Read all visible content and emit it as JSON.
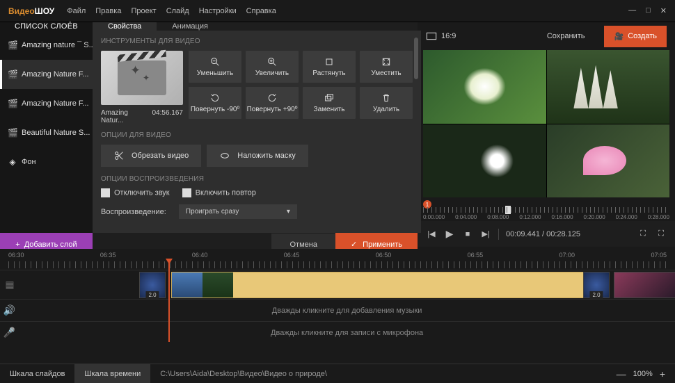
{
  "app": {
    "logo1": "Видео",
    "logo2": "ШОУ"
  },
  "menu": [
    "Файл",
    "Правка",
    "Проект",
    "Слайд",
    "Настройки",
    "Справка"
  ],
  "left": {
    "layers_title": "СПИСОК СЛОЁВ",
    "tabs": {
      "props": "Свойства",
      "anim": "Анимация"
    },
    "layers": [
      {
        "label": "Amazing nature ¯ S..."
      },
      {
        "label": "Amazing Nature F..."
      },
      {
        "label": "Amazing Nature F..."
      },
      {
        "label": "Beautiful Nature S..."
      },
      {
        "label": "Фон"
      }
    ],
    "sections": {
      "video_tools": "ИНСТРУМЕНТЫ ДЛЯ ВИДЕО",
      "video_opts": "ОПЦИИ ДЛЯ ВИДЕО",
      "play_opts": "ОПЦИИ ВОСПРОИЗВЕДЕНИЯ"
    },
    "thumb": {
      "name": "Amazing Natur...",
      "duration": "04:56.167"
    },
    "tools": {
      "zoom_out": "Уменьшить",
      "zoom_in": "Увеличить",
      "stretch": "Растянуть",
      "fit": "Уместить",
      "rot_left": "Повернуть -90º",
      "rot_right": "Повернуть +90º",
      "replace": "Заменить",
      "delete": "Удалить"
    },
    "wide": {
      "crop": "Обрезать видео",
      "mask": "Наложить маску"
    },
    "checks": {
      "mute": "Отключить звук",
      "loop": "Включить повтор"
    },
    "playback_label": "Воспроизведение:",
    "playback_value": "Проиграть сразу",
    "add_layer": "Добавить слой",
    "cancel": "Отмена",
    "apply": "Применить"
  },
  "right": {
    "aspect": "16:9",
    "save": "Сохранить",
    "create": "Создать",
    "ruler": [
      "0:00.000",
      "0:04.000",
      "0:08.000",
      "0:12.000",
      "0:16.000",
      "0:20.000",
      "0:24.000",
      "0:28.000"
    ],
    "playhead_num": "1",
    "time": "00:09.441 / 00:28.125"
  },
  "timeline": {
    "ruler": [
      "06:30",
      "06:35",
      "06:40",
      "06:45",
      "06:50",
      "06:55",
      "07:00",
      "07:05"
    ],
    "trans_badge": "2.0",
    "music_placeholder": "Дважды кликните для добавления музыки",
    "mic_placeholder": "Дважды кликните для записи с микрофона"
  },
  "bottom": {
    "tab1": "Шкала слайдов",
    "tab2": "Шкала времени",
    "path": "C:\\Users\\Aida\\Desktop\\Видео\\Видео о природе\\",
    "zoom": "100%"
  }
}
